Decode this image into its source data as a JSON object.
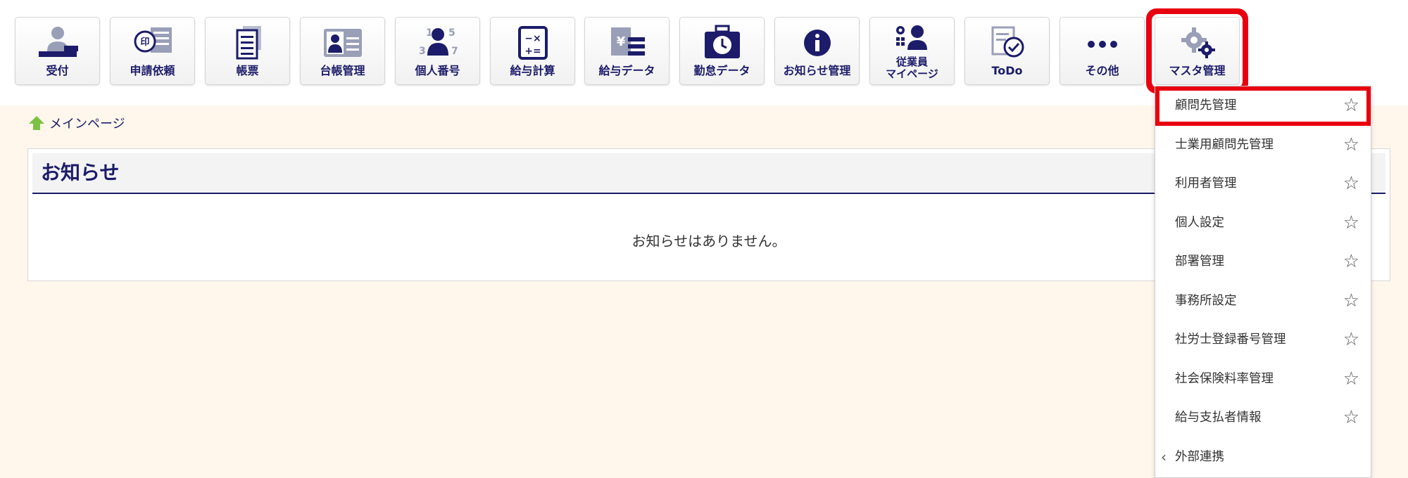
{
  "toolbar": {
    "buttons": [
      {
        "label": "受付",
        "icon": "reception-icon"
      },
      {
        "label": "申請依頼",
        "icon": "seal-form-icon"
      },
      {
        "label": "帳票",
        "icon": "documents-icon"
      },
      {
        "label": "台帳管理",
        "icon": "id-card-icon"
      },
      {
        "label": "個人番号",
        "icon": "personal-number-icon"
      },
      {
        "label": "給与計算",
        "icon": "calculator-icon"
      },
      {
        "label": "給与データ",
        "icon": "yen-data-icon"
      },
      {
        "label": "勤怠データ",
        "icon": "clock-bag-icon"
      },
      {
        "label": "お知らせ管理",
        "icon": "info-icon"
      },
      {
        "label_line1": "従業員",
        "label_line2": "マイページ",
        "icon": "employee-gear-icon"
      },
      {
        "label": "ToDo",
        "icon": "todo-check-icon"
      },
      {
        "label": "その他",
        "icon": "more-dots-icon"
      },
      {
        "label": "マスタ管理",
        "icon": "gears-icon"
      }
    ],
    "active_index": 12
  },
  "breadcrumb": {
    "label": "メインページ"
  },
  "notice": {
    "title": "お知らせ",
    "empty_message": "お知らせはありません。"
  },
  "dropdown": {
    "items": [
      {
        "label": "顧問先管理"
      },
      {
        "label": "士業用顧問先管理"
      },
      {
        "label": "利用者管理"
      },
      {
        "label": "個人設定"
      },
      {
        "label": "部署管理"
      },
      {
        "label": "事務所設定"
      },
      {
        "label": "社労士登録番号管理"
      },
      {
        "label": "社会保険料率管理"
      },
      {
        "label": "給与支払者情報"
      },
      {
        "label": "外部連携"
      }
    ],
    "star_glyph": "☆",
    "chevron_glyph": "‹"
  },
  "colors": {
    "navy": "#1c1c6a",
    "highlight_red": "#e8000f",
    "background_cream": "#fff7ec",
    "home_green": "#7cc242"
  }
}
